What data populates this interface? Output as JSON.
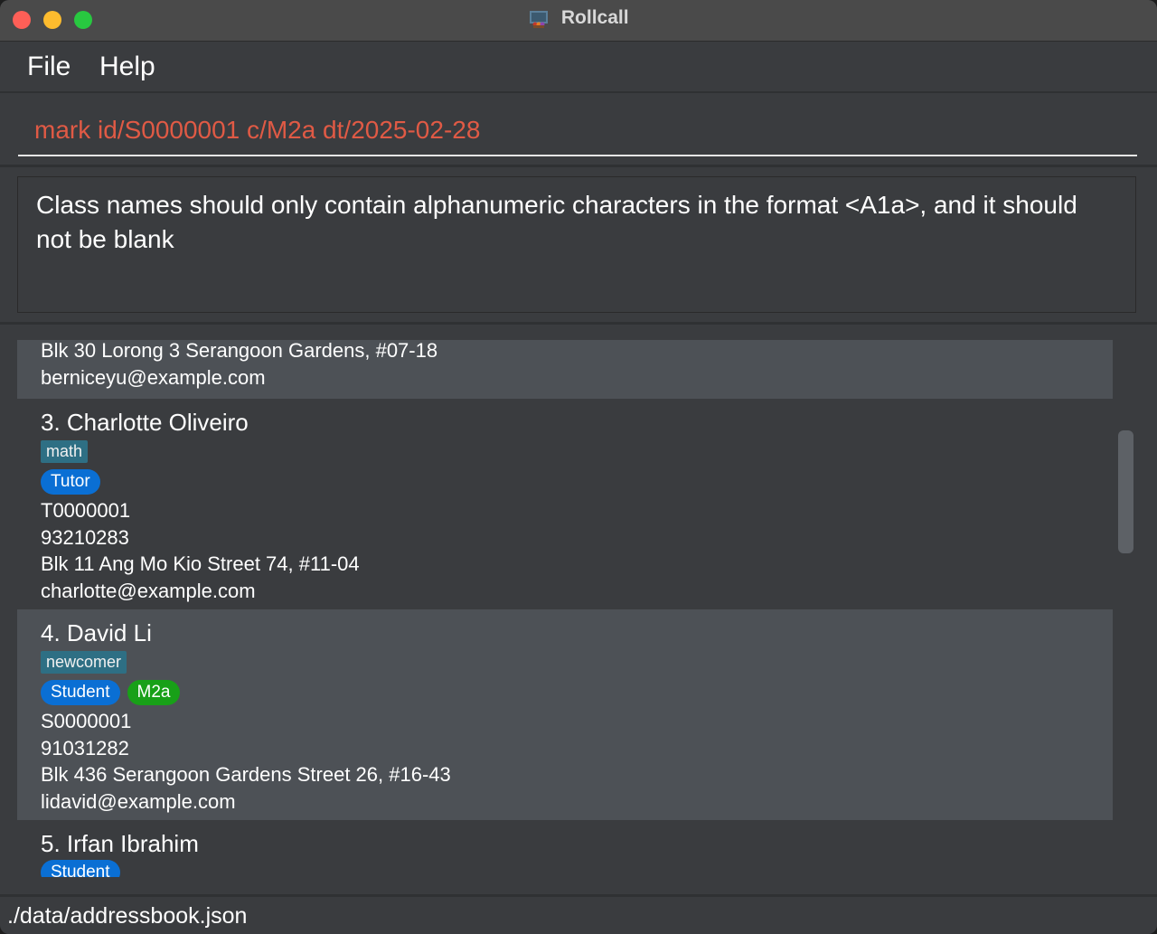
{
  "window": {
    "title": "Rollcall",
    "app_icon": "rollcall-app-icon"
  },
  "menu": {
    "file": "File",
    "help": "Help"
  },
  "command": {
    "value": "mark id/S0000001 c/M2a dt/2025-02-28",
    "text_color": "#e05a45"
  },
  "result": {
    "message": "Class names should only contain alphanumeric characters in the format <A1a>, and it should not be blank"
  },
  "persons": [
    {
      "partial": true,
      "address": "Blk 30 Lorong 3 Serangoon Gardens, #07-18",
      "email": "berniceyu@example.com"
    },
    {
      "name": "3. Charlotte Oliveiro",
      "tags": [
        "math"
      ],
      "roles": [
        {
          "label": "Tutor",
          "color": "blue"
        }
      ],
      "id": "T0000001",
      "phone": "93210283",
      "address": "Blk 11 Ang Mo Kio Street 74, #11-04",
      "email": "charlotte@example.com"
    },
    {
      "name": "4. David Li",
      "tags": [
        "newcomer"
      ],
      "roles": [
        {
          "label": "Student",
          "color": "blue"
        },
        {
          "label": "M2a",
          "color": "green"
        }
      ],
      "id": "S0000001",
      "phone": "91031282",
      "address": "Blk 436 Serangoon Gardens Street 26, #16-43",
      "email": "lidavid@example.com"
    },
    {
      "name": "5. Irfan Ibrahim",
      "roles": [
        {
          "label": "Student",
          "color": "blue"
        }
      ]
    }
  ],
  "status": {
    "path": "./data/addressbook.json"
  },
  "colors": {
    "tag_bg": "#2e6f84",
    "role_blue": "#0a6fd4",
    "class_green": "#18a018",
    "card_light": "#4d5156",
    "card_dark": "#3a3c3f"
  }
}
